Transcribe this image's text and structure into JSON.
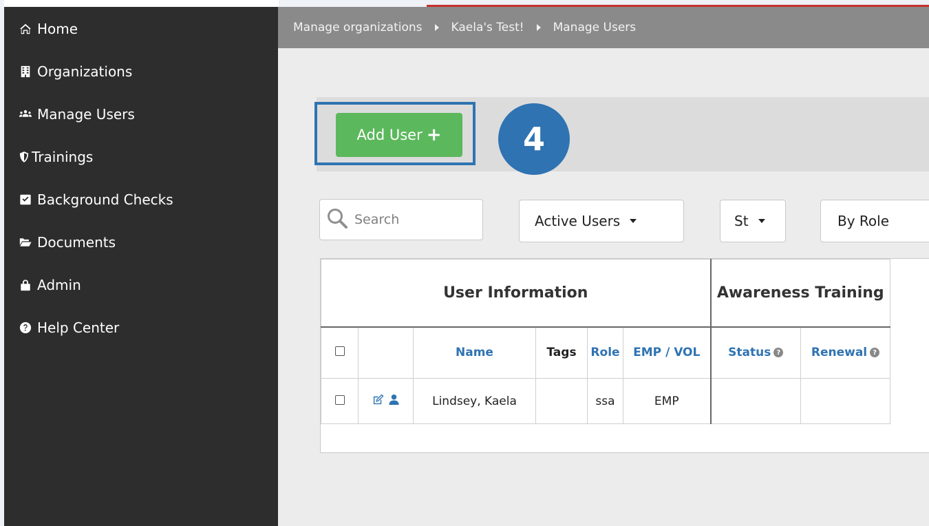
{
  "sidebar": {
    "items": [
      {
        "label": "Home",
        "icon": "home-icon"
      },
      {
        "label": "Organizations",
        "icon": "building-icon"
      },
      {
        "label": "Manage Users",
        "icon": "users-icon"
      },
      {
        "label": "Trainings",
        "icon": "shield-icon"
      },
      {
        "label": "Background Checks",
        "icon": "checkbox-icon"
      },
      {
        "label": "Documents",
        "icon": "folder-open-icon"
      },
      {
        "label": "Admin",
        "icon": "lock-icon"
      },
      {
        "label": "Help Center",
        "icon": "question-circle-icon"
      }
    ]
  },
  "breadcrumb": {
    "items": [
      "Manage organizations",
      "Kaela's Test!",
      "Manage Users"
    ]
  },
  "actions": {
    "add_user_label": "Add User",
    "add_user_icon": "plus-icon",
    "step_number": "4"
  },
  "filters": {
    "search_placeholder": "Search",
    "user_status": "Active Users",
    "status_filter": "St",
    "role_filter": "By Role"
  },
  "table": {
    "group_headers": [
      "User Information",
      "Awareness Training"
    ],
    "columns": [
      "Name",
      "Tags",
      "Role",
      "EMP / VOL",
      "Status",
      "Renewal"
    ],
    "rows": [
      {
        "name": "Lindsey, Kaela",
        "tags": "",
        "role": "ssa",
        "emp_vol": "EMP",
        "status": "",
        "renewal": ""
      }
    ]
  },
  "colors": {
    "sidebar_bg": "#2d2d2d",
    "breadcrumb_bg": "#8a8a8a",
    "add_button": "#5cb85c",
    "highlight": "#2f73b2",
    "link_blue": "#2f73b2"
  }
}
